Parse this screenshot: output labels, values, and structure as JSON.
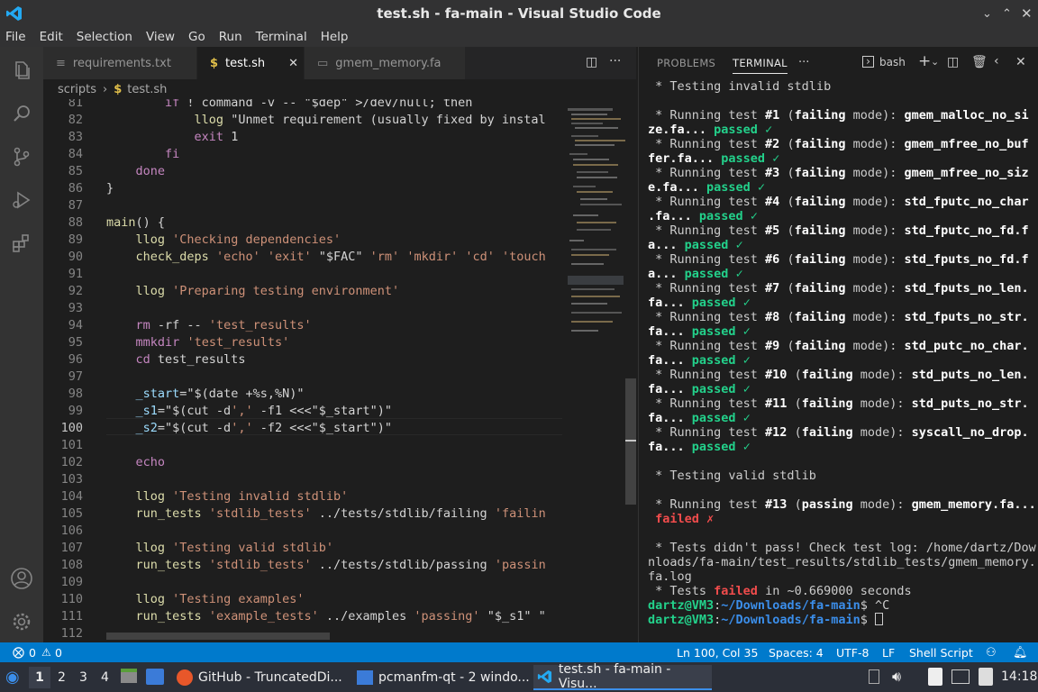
{
  "window": {
    "title": "test.sh - fa-main - Visual Studio Code"
  },
  "menu": [
    "File",
    "Edit",
    "Selection",
    "View",
    "Go",
    "Run",
    "Terminal",
    "Help"
  ],
  "tabs": [
    {
      "label": "requirements.txt"
    },
    {
      "label": "test.sh"
    },
    {
      "label": "gmem_memory.fa"
    }
  ],
  "breadcrumb": {
    "folder": "scripts",
    "sep": "›",
    "file": "test.sh"
  },
  "line_numbers": [
    "81",
    "82",
    "83",
    "84",
    "85",
    "86",
    "87",
    "88",
    "89",
    "90",
    "91",
    "92",
    "93",
    "94",
    "95",
    "96",
    "97",
    "98",
    "99",
    "100",
    "101",
    "102",
    "103",
    "104",
    "105",
    "106",
    "107",
    "108",
    "109",
    "110",
    "111",
    "112"
  ],
  "code_lines": [
    "        if ! command -v -- \"$dep\" >/dev/null; then",
    "            llog \"Unmet requirement (usually fixed by instal",
    "            exit 1",
    "        fi",
    "    done",
    "}",
    "",
    "main() {",
    "    llog 'Checking dependencies'",
    "    check_deps 'echo' 'exit' \"$FAC\" 'rm' 'mkdir' 'cd' 'touch",
    "",
    "    llog 'Preparing testing environment'",
    "",
    "    rm -rf -- 'test_results'",
    "    mmkdir 'test_results'",
    "    cd test_results",
    "",
    "    _start=\"$(date +%s,%N)\"",
    "    _s1=\"$(cut -d',' -f1 <<<\"$_start\")\"",
    "    _s2=\"$(cut -d',' -f2 <<<\"$_start\")\"",
    "",
    "    echo",
    "",
    "    llog 'Testing invalid stdlib'",
    "    run_tests 'stdlib_tests' ../tests/stdlib/failing 'failin",
    "",
    "    llog 'Testing valid stdlib'",
    "    run_tests 'stdlib_tests' ../tests/stdlib/passing 'passin",
    "",
    "    llog 'Testing examples'",
    "    run_tests 'example_tests' ../examples 'passing' \"$_s1\" \"",
    ""
  ],
  "panel": {
    "tabs": [
      "PROBLEMS",
      "TERMINAL"
    ],
    "shell": "bash"
  },
  "terminal": {
    "invalid_header": " * Testing invalid stdlib",
    "tests": [
      {
        "pre": " * Running test ",
        "num": "#1",
        "mode": "failing",
        "name": "gmem_malloc_no_size.fa",
        "result": "passed ✓"
      },
      {
        "pre": " * Running test ",
        "num": "#2",
        "mode": "failing",
        "name": "gmem_mfree_no_buffer.fa",
        "result": "passed ✓"
      },
      {
        "pre": " * Running test ",
        "num": "#3",
        "mode": "failing",
        "name": "gmem_mfree_no_size.fa",
        "result": "passed ✓"
      },
      {
        "pre": " * Running test ",
        "num": "#4",
        "mode": "failing",
        "name": "std_fputc_no_char.fa",
        "result": "passed ✓"
      },
      {
        "pre": " * Running test ",
        "num": "#5",
        "mode": "failing",
        "name": "std_fputc_no_fd.fa",
        "result": "passed ✓"
      },
      {
        "pre": " * Running test ",
        "num": "#6",
        "mode": "failing",
        "name": "std_fputs_no_fd.fa",
        "result": "passed ✓"
      },
      {
        "pre": " * Running test ",
        "num": "#7",
        "mode": "failing",
        "name": "std_fputs_no_len.fa",
        "result": "passed ✓"
      },
      {
        "pre": " * Running test ",
        "num": "#8",
        "mode": "failing",
        "name": "std_fputs_no_str.fa",
        "result": "passed ✓"
      },
      {
        "pre": " * Running test ",
        "num": "#9",
        "mode": "failing",
        "name": "std_putc_no_char.fa",
        "result": "passed ✓"
      },
      {
        "pre": " * Running test ",
        "num": "#10",
        "mode": "failing",
        "name": "std_puts_no_len.fa",
        "result": "passed ✓"
      },
      {
        "pre": " * Running test ",
        "num": "#11",
        "mode": "failing",
        "name": "std_puts_no_str.fa",
        "result": "passed ✓"
      },
      {
        "pre": " * Running test ",
        "num": "#12",
        "mode": "failing",
        "name": "syscall_no_drop.fa",
        "result": "passed ✓"
      }
    ],
    "valid_header": " * Testing valid stdlib",
    "test13": {
      "pre": " * Running test ",
      "num": "#13",
      "mode": "passing",
      "name": "gmem_memory.fa...",
      "result": "failed ✗"
    },
    "fail_msg": [
      " * Tests didn't pass! Check test log: /home/dartz/Dow",
      "nloads/fa-main/test_results/stdlib_tests/gmem_memory.",
      "fa.log"
    ],
    "summary": {
      "pre": " * Tests ",
      "word": "failed",
      "post": " in ~0.669000 seconds"
    },
    "prompt_user": "dartz@VM3",
    "prompt_path": "~/Downloads/fa-main",
    "prompt_end": "$ ",
    "cmd1": "^C"
  },
  "status": {
    "errors": "0",
    "warnings": "0",
    "position": "Ln 100, Col 35",
    "spaces": "Spaces: 4",
    "encoding": "UTF-8",
    "eol": "LF",
    "language": "Shell Script"
  },
  "taskbar": {
    "workspaces": [
      "1",
      "2",
      "3",
      "4"
    ],
    "tasks": [
      "GitHub - TruncatedDi...",
      "pcmanfm-qt - 2 windo...",
      "test.sh - fa-main - Visu..."
    ],
    "clock": "14:18"
  },
  "colors": {
    "accent": "#007acc",
    "term_green": "#23d18b",
    "term_red": "#f14c4c",
    "term_blue": "#3b8eea"
  }
}
